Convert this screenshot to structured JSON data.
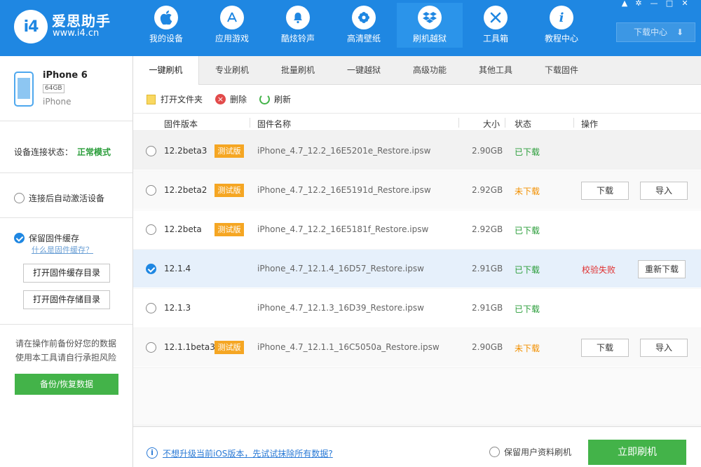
{
  "app": {
    "brand_name": "爱思助手",
    "brand_url": "www.i4.cn",
    "logo_text": "i4"
  },
  "nav": {
    "items": [
      {
        "label": "我的设备",
        "icon": "apple-icon",
        "glyph": ""
      },
      {
        "label": "应用游戏",
        "icon": "appstore-icon",
        "glyph": "A"
      },
      {
        "label": "酷炫铃声",
        "icon": "bell-icon",
        "glyph": "🔔"
      },
      {
        "label": "高清壁纸",
        "icon": "flower-icon",
        "glyph": "✿"
      },
      {
        "label": "刷机越狱",
        "icon": "dropbox-icon",
        "glyph": "◈"
      },
      {
        "label": "工具箱",
        "icon": "tools-icon",
        "glyph": "✕"
      },
      {
        "label": "教程中心",
        "icon": "info-icon",
        "glyph": "i"
      }
    ],
    "download_center": "下载中心"
  },
  "device": {
    "name": "iPhone 6",
    "capacity": "64GB",
    "type": "iPhone",
    "status_label": "设备连接状态：",
    "status_value": "正常模式"
  },
  "sidebar": {
    "auto_activate": "连接后自动激活设备",
    "keep_cache": "保留固件缓存",
    "what_is_cache": "什么是固件缓存？",
    "open_cache_dir": "打开固件缓存目录",
    "open_storage_dir": "打开固件存储目录",
    "warn_line1": "请在操作前备份好您的数据",
    "warn_line2": "使用本工具请自行承担风险",
    "backup_button": "备份/恢复数据"
  },
  "tabs": [
    "一键刷机",
    "专业刷机",
    "批量刷机",
    "一键越狱",
    "高级功能",
    "其他工具",
    "下载固件"
  ],
  "toolbar": {
    "open_folder": "打开文件夹",
    "delete": "删除",
    "refresh": "刷新"
  },
  "table": {
    "headers": {
      "version": "固件版本",
      "name": "固件名称",
      "size": "大小",
      "status": "状态",
      "action": "操作"
    },
    "beta_label": "测试版",
    "rows": [
      {
        "version": "12.2beta3",
        "beta": true,
        "name": "iPhone_4.7_12.2_16E5201e_Restore.ipsw",
        "size": "2.90GB",
        "status": "已下载",
        "selected": false
      },
      {
        "version": "12.2beta2",
        "beta": true,
        "name": "iPhone_4.7_12.2_16E5191d_Restore.ipsw",
        "size": "2.92GB",
        "status": "未下载",
        "selected": false,
        "actions": [
          "下载",
          "导入"
        ]
      },
      {
        "version": "12.2beta",
        "beta": true,
        "name": "iPhone_4.7_12.2_16E5181f_Restore.ipsw",
        "size": "2.92GB",
        "status": "已下载",
        "selected": false
      },
      {
        "version": "12.1.4",
        "beta": false,
        "name": "iPhone_4.7_12.1.4_16D57_Restore.ipsw",
        "size": "2.91GB",
        "status": "已下载",
        "selected": true,
        "fail": "校验失败",
        "actions": [
          "重新下载"
        ]
      },
      {
        "version": "12.1.3",
        "beta": false,
        "name": "iPhone_4.7_12.1.3_16D39_Restore.ipsw",
        "size": "2.91GB",
        "status": "已下载",
        "selected": false
      },
      {
        "version": "12.1.1beta3",
        "beta": true,
        "name": "iPhone_4.7_12.1.1_16C5050a_Restore.ipsw",
        "size": "2.90GB",
        "status": "未下载",
        "selected": false,
        "actions": [
          "下载",
          "导入"
        ]
      }
    ]
  },
  "footer": {
    "link": "不想升级当前iOS版本，先试试抹除所有数据?",
    "keep_user_data": "保留用户资料刷机",
    "flash_button": "立即刷机"
  },
  "colors": {
    "brand_blue": "#1f87e2",
    "green": "#43b349",
    "orange_badge": "#f5a623",
    "downloaded": "#2a9d3a",
    "not_downloaded": "#f29000",
    "fail_red": "#e02e2e"
  }
}
